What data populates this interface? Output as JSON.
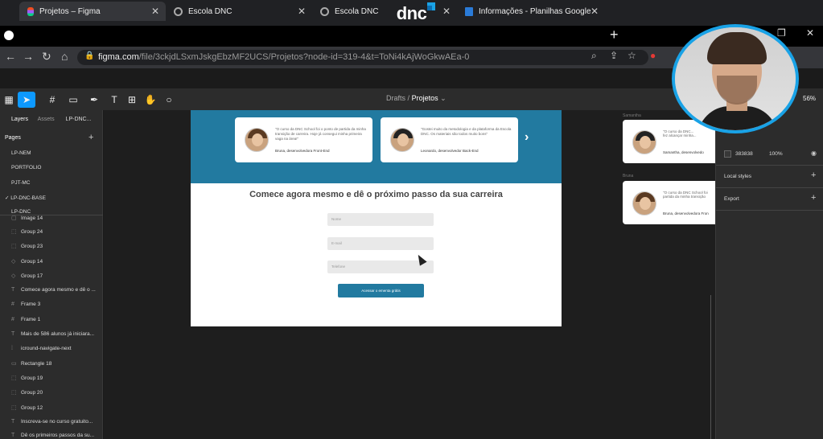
{
  "brand": {
    "logo_text": "dnc"
  },
  "browser": {
    "tabs": [
      {
        "label": "Projetos – Figma"
      },
      {
        "label": "Escola DNC"
      },
      {
        "label": "Escola DNC"
      },
      {
        "label": "Informações - Planilhas Google"
      }
    ],
    "url_host": "figma.com",
    "url_path": "/file/3ckjdLSxmJskgEbzMF2UCS/Projetos?node-id=319-4&t=ToNi4kAjWoGkwAEa-0"
  },
  "figma": {
    "breadcrumb": {
      "parent": "Drafts",
      "separator": "/",
      "current": "Projetos"
    },
    "zoom": "56%",
    "left_panel": {
      "tabs": {
        "layers": "Layers",
        "assets": "Assets",
        "page": "LP-DNC..."
      },
      "pages_title": "Pages",
      "pages": [
        "LP-NEM",
        "PORTFOLIO",
        "PJT-MC",
        "LP-DNC-BASE",
        "LP-DNC"
      ],
      "current_page_check": "✓",
      "layers": [
        "Image 14",
        "Group 24",
        "Group 23",
        "Group 14",
        "Group 17",
        "Comece agora mesmo e dê o ...",
        "Frame 3",
        "Frame 1",
        "Mais de 586 alunos já iniciara...",
        "icround-navigate-next",
        "Rectangle 18",
        "Group 19",
        "Group 20",
        "Group 12",
        "Inscreva-se no curso gratuito...",
        "Dê os primeiros passos da su..."
      ]
    },
    "right_panel": {
      "fill_hex": "383838",
      "fill_opacity": "100%",
      "local_styles": "Local styles",
      "export": "Export"
    },
    "canvas": {
      "testimonials": [
        {
          "quote": "\"O curso da DNC School foi o ponto de partida da minha transição de carreira. Hoje já consegui minha primeira vaga na área!\"",
          "author": "Bruna, desenvolvedora Front-End"
        },
        {
          "quote": "\"Gostei muito da metodologia e da plataforma da Escola DNC. Os materiais são todos muito bons\"",
          "author": "Leonardo, desenvolvedor Back-End"
        }
      ],
      "next_arrow": "›",
      "form_title": "Comece agora mesmo e dê o próximo passo da sua carreira",
      "inputs": [
        {
          "placeholder": "Nome"
        },
        {
          "placeholder": "E-mail"
        },
        {
          "placeholder": "Telefone"
        }
      ],
      "cta": "Acessar o ementa grátis",
      "side_cards": [
        {
          "label": "Samantha",
          "quote": "\"O curso da DNC...",
          "quote2": "fez alcançar minha...",
          "author": "Samantha, desenvolvedo"
        },
        {
          "label": "Bruna",
          "quote": "\"O curso da DNC School foi",
          "quote2": "partida da minha transição",
          "author": "Bruna, desenvolvedora Fron"
        }
      ]
    }
  }
}
